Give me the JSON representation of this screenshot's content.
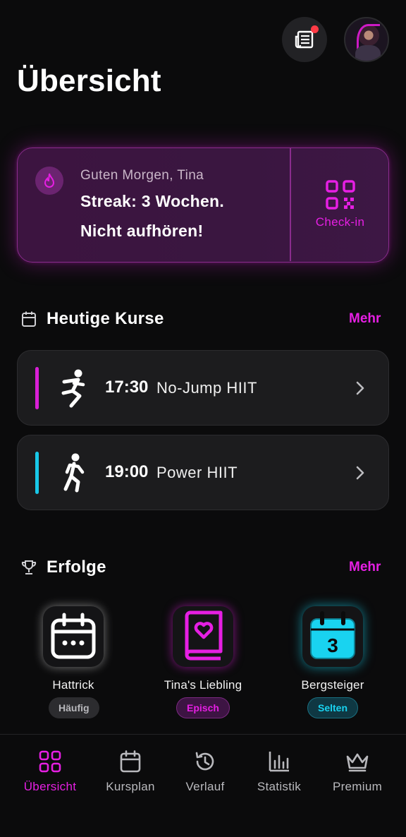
{
  "header": {
    "title": "Übersicht",
    "news_icon": "newspaper-icon",
    "has_notification": true,
    "avatar": "profile-avatar"
  },
  "streak": {
    "greeting": "Guten Morgen, Tina",
    "line1": "Streak: 3 Wochen.",
    "line2": "Nicht aufhören!",
    "checkin_label": "Check-in",
    "accent_color": "#e61fe3"
  },
  "today_classes": {
    "title": "Heutige Kurse",
    "more_label": "Mehr",
    "items": [
      {
        "time": "17:30",
        "name": "No-Jump HIIT",
        "color": "#d91fd6",
        "icon": "runner-icon"
      },
      {
        "time": "19:00",
        "name": "Power HIIT",
        "color": "#18c8e8",
        "icon": "running-man-icon"
      }
    ]
  },
  "achievements": {
    "title": "Erfolge",
    "more_label": "Mehr",
    "items": [
      {
        "title": "Hattrick",
        "rarity": "Häufig",
        "icon": "calendar-dots-icon",
        "color": "#ffffff"
      },
      {
        "title": "Tina's Liebling",
        "rarity": "Episch",
        "icon": "heart-book-icon",
        "color": "#e61fe3"
      },
      {
        "title": "Bergsteiger",
        "rarity": "Selten",
        "icon": "calendar-3-icon",
        "color": "#19d3f0",
        "number": "3"
      }
    ]
  },
  "nav": {
    "items": [
      {
        "label": "Übersicht",
        "icon": "grid-icon",
        "active": true
      },
      {
        "label": "Kursplan",
        "icon": "calendar-icon",
        "active": false
      },
      {
        "label": "Verlauf",
        "icon": "history-icon",
        "active": false
      },
      {
        "label": "Statistik",
        "icon": "bar-chart-icon",
        "active": false
      },
      {
        "label": "Premium",
        "icon": "crown-icon",
        "active": false
      }
    ]
  }
}
